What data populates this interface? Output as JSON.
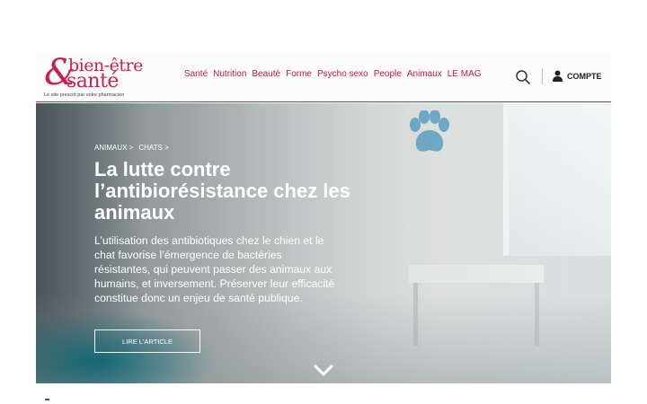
{
  "brand": {
    "line1": "bien-être",
    "line2": "santé",
    "ampersand": "&",
    "tagline": "Le site prescrit par votre pharmacien",
    "color": "#c8224e"
  },
  "nav": {
    "items": [
      {
        "label": "Santé"
      },
      {
        "label": "Nutrition"
      },
      {
        "label": "Beauté"
      },
      {
        "label": "Forme"
      },
      {
        "label": "Psycho sexo"
      },
      {
        "label": "People"
      },
      {
        "label": "Animaux"
      },
      {
        "label": "LE MAG"
      }
    ]
  },
  "header": {
    "search_icon": "search-icon",
    "account_icon": "user-icon",
    "account_label": "COMPTE"
  },
  "hero": {
    "breadcrumb": [
      "ANIMAUX >",
      "CHATS >"
    ],
    "title": "La lutte contre l’antibiorésistance chez les animaux",
    "lead": "L’utilisation des antibiotiques chez le chien et le chat favorise l’émergence de bactéries résistantes, qui peuvent passer des animaux aux humains, et inversement. Préserver leur efficacité constitue donc un enjeu de santé publique.",
    "cta_label": "LIRE L'ARTICLE",
    "scroll_icon": "chevron-down-icon"
  }
}
